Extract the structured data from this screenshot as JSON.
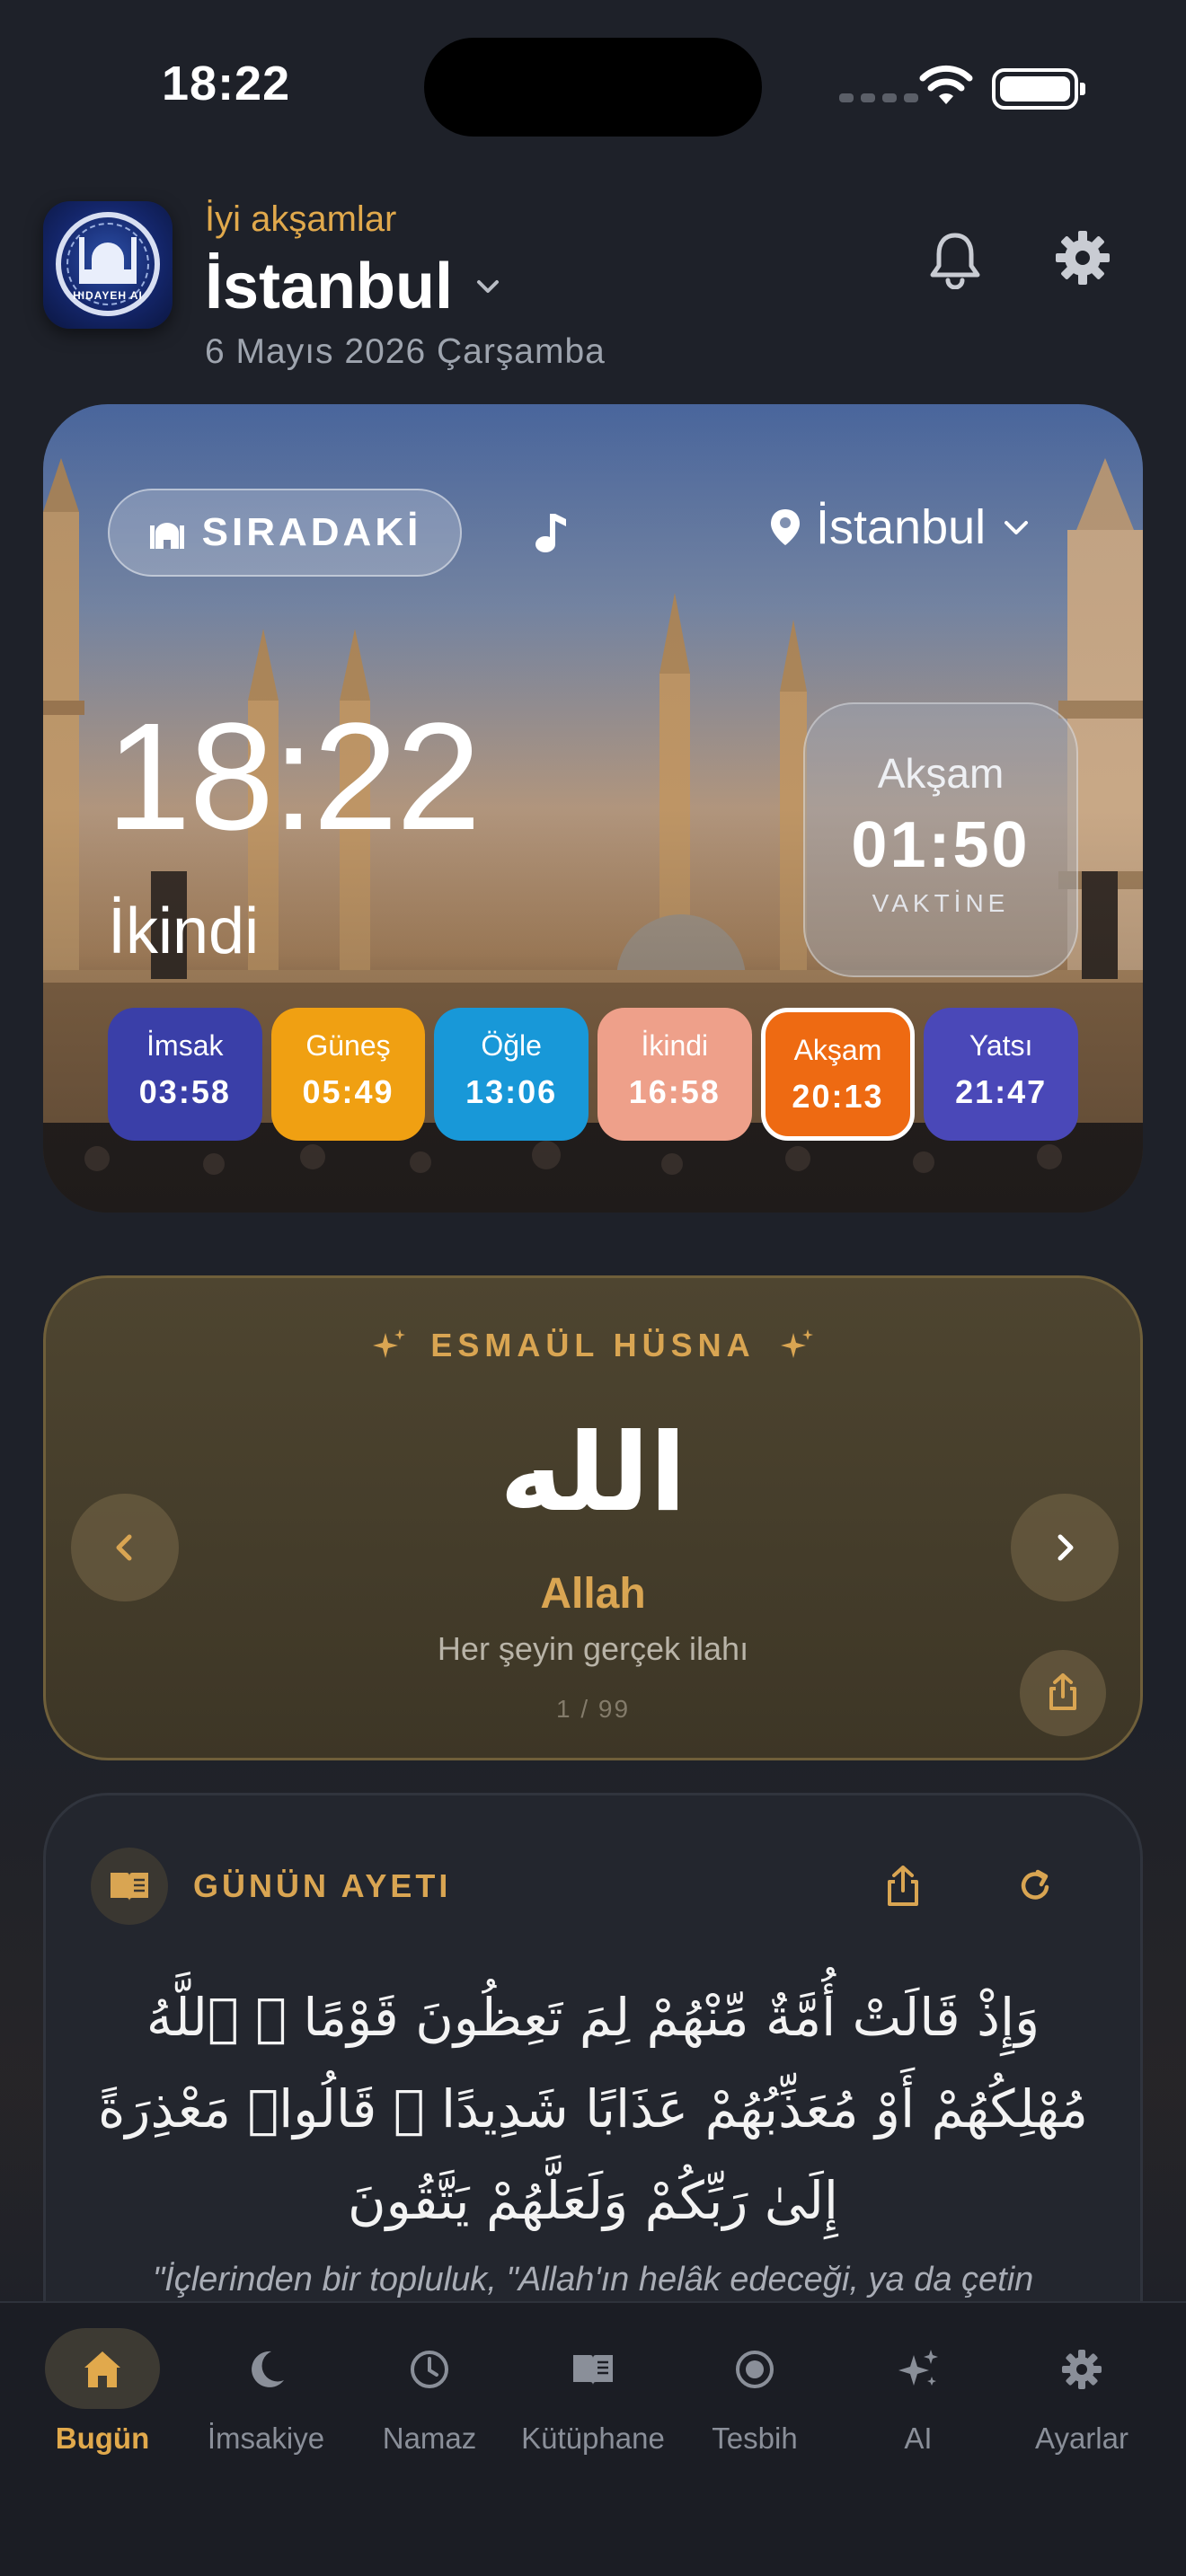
{
  "status_bar": {
    "time": "18:22"
  },
  "header": {
    "greeting": "İyi akşamlar",
    "city": "İstanbul",
    "date": "6 Mayıs 2026 Çarşamba",
    "logo_text": "HIDAYEH AI"
  },
  "prayer_card": {
    "next_label": "SIRADAKİ",
    "location": "İstanbul",
    "clock": "18:22",
    "current_prayer": "İkindi",
    "countdown": {
      "name": "Akşam",
      "time": "01:50",
      "suffix": "VAKTİNE"
    },
    "times": [
      {
        "name": "İmsak",
        "time": "03:58",
        "color": "#3a3fa8"
      },
      {
        "name": "Güneş",
        "time": "05:49",
        "color": "#f0a012"
      },
      {
        "name": "Öğle",
        "time": "13:06",
        "color": "#1898d8"
      },
      {
        "name": "İkindi",
        "time": "16:58",
        "color": "#eea08a"
      },
      {
        "name": "Akşam",
        "time": "20:13",
        "color": "#ee6a12",
        "active": true
      },
      {
        "name": "Yatsı",
        "time": "21:47",
        "color": "#4a48b8"
      }
    ]
  },
  "esma": {
    "title": "ESMAÜL HÜSNA",
    "arabic": "الله",
    "name": "Allah",
    "meaning": "Her şeyin gerçek ilahı",
    "counter": "1 / 99"
  },
  "verse": {
    "title": "GÜNÜN AYETI",
    "arabic": "وَإِذْ قَالَتْ أُمَّةٌ مِّنْهُمْ لِمَ تَعِظُونَ قَوْمًا ۙ ٱللَّهُ مُهْلِكُهُمْ أَوْ مُعَذِّبُهُمْ عَذَابًا شَدِيدًا ۖ قَالُوا۟ مَعْذِرَةً إِلَىٰ رَبِّكُمْ وَلَعَلَّهُمْ يَتَّقُونَ",
    "translation": "\"İçlerinden bir topluluk, \"Allah'ın helâk edeceği, ya da çetin"
  },
  "tabs": [
    {
      "label": "Bugün",
      "icon": "home-icon",
      "active": true
    },
    {
      "label": "İmsakiye",
      "icon": "moon-icon"
    },
    {
      "label": "Namaz",
      "icon": "clock-icon"
    },
    {
      "label": "Kütüphane",
      "icon": "book-icon"
    },
    {
      "label": "Tesbih",
      "icon": "tesbih-icon"
    },
    {
      "label": "AI",
      "icon": "sparkle-icon"
    },
    {
      "label": "Ayarlar",
      "icon": "gear-icon"
    }
  ],
  "colors": {
    "accent": "#e1a94c",
    "background": "#1e2129"
  }
}
